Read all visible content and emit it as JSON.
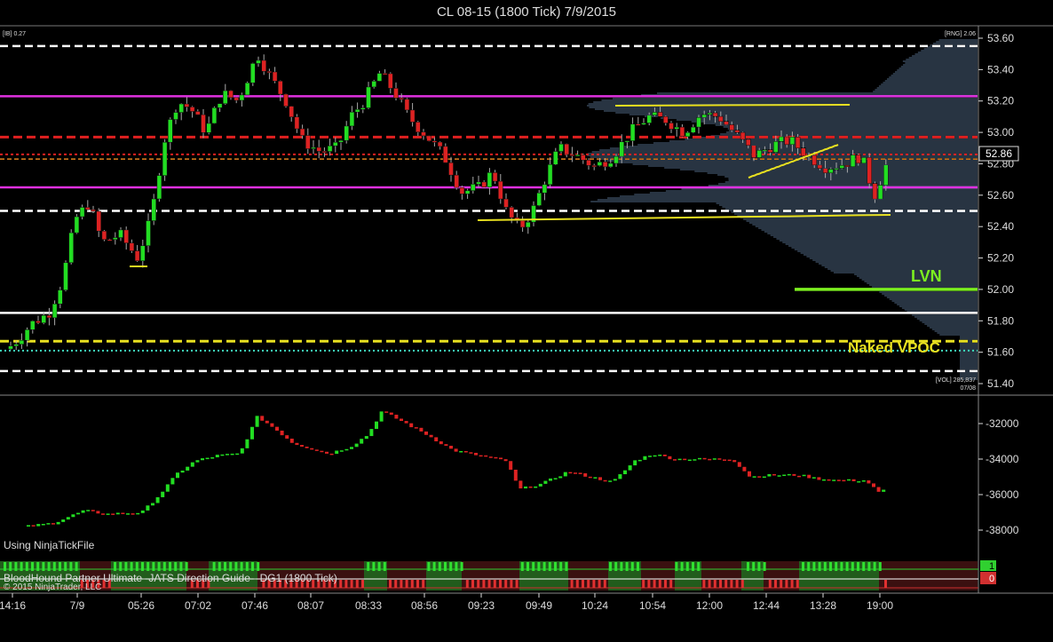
{
  "window": {
    "title": "CL 08-15 (1800 Tick)  7/9/2015"
  },
  "indicators": {
    "ib_label": "[IB] 0.27",
    "rng_label": "[RNG] 2.06",
    "vol_label": "[VOL] 285,837",
    "vol_date": "07/08",
    "lvn_label": "LVN",
    "naked_vpoc_label": "Naked VPOC",
    "using_file": "Using NinjaTickFile",
    "direction_guide": "BloodHound Partner Ultimate- JATS Direction Guide - DG1 (1800 Tick)",
    "copyright": "© 2015 NinjaTrader, LLC",
    "guide_values": [
      "1",
      "0"
    ]
  },
  "price_axis": {
    "ticks": [
      "53.60",
      "53.40",
      "53.20",
      "53.00",
      "52.80",
      "52.60",
      "52.40",
      "52.20",
      "52.00",
      "51.80",
      "51.60",
      "51.40"
    ],
    "current_price": "52.86"
  },
  "lower_axis": {
    "ticks": [
      "-32000",
      "-34000",
      "-36000",
      "-38000"
    ]
  },
  "time_axis": {
    "ticks": [
      "14:16",
      "7/9",
      "05:26",
      "07:02",
      "07:46",
      "08:07",
      "08:33",
      "08:56",
      "09:23",
      "09:49",
      "10:24",
      "10:54",
      "12:00",
      "12:44",
      "13:28",
      "19:00"
    ]
  },
  "colors": {
    "background": "#000000",
    "up": "#22dd22",
    "down": "#dd2222",
    "magenta": "#e030e0",
    "red_level": "#e02020",
    "orange_level": "#e08020",
    "yellow": "#e8e020",
    "white_level": "#ffffff",
    "profile": "#6b8ab0",
    "lvn": "#7cf020",
    "vpoc_text": "#e8e020"
  },
  "chart_data": {
    "type": "candlestick",
    "instrument": "CL 08-15",
    "price_ylim": [
      51.4,
      53.6
    ],
    "price_levels": {
      "dashed_white": [
        53.55,
        52.5,
        51.48
      ],
      "magenta": [
        53.23,
        52.65
      ],
      "red_dashed": [
        52.97
      ],
      "red_dotted": [
        52.86
      ],
      "orange": [
        52.83
      ],
      "white_solid": [
        51.85
      ],
      "yellow_dashed": [
        51.67
      ],
      "cyan_dotted": [
        51.61
      ],
      "lvn": [
        52.0
      ]
    },
    "lower_ylim": [
      -39000,
      -31000
    ]
  }
}
